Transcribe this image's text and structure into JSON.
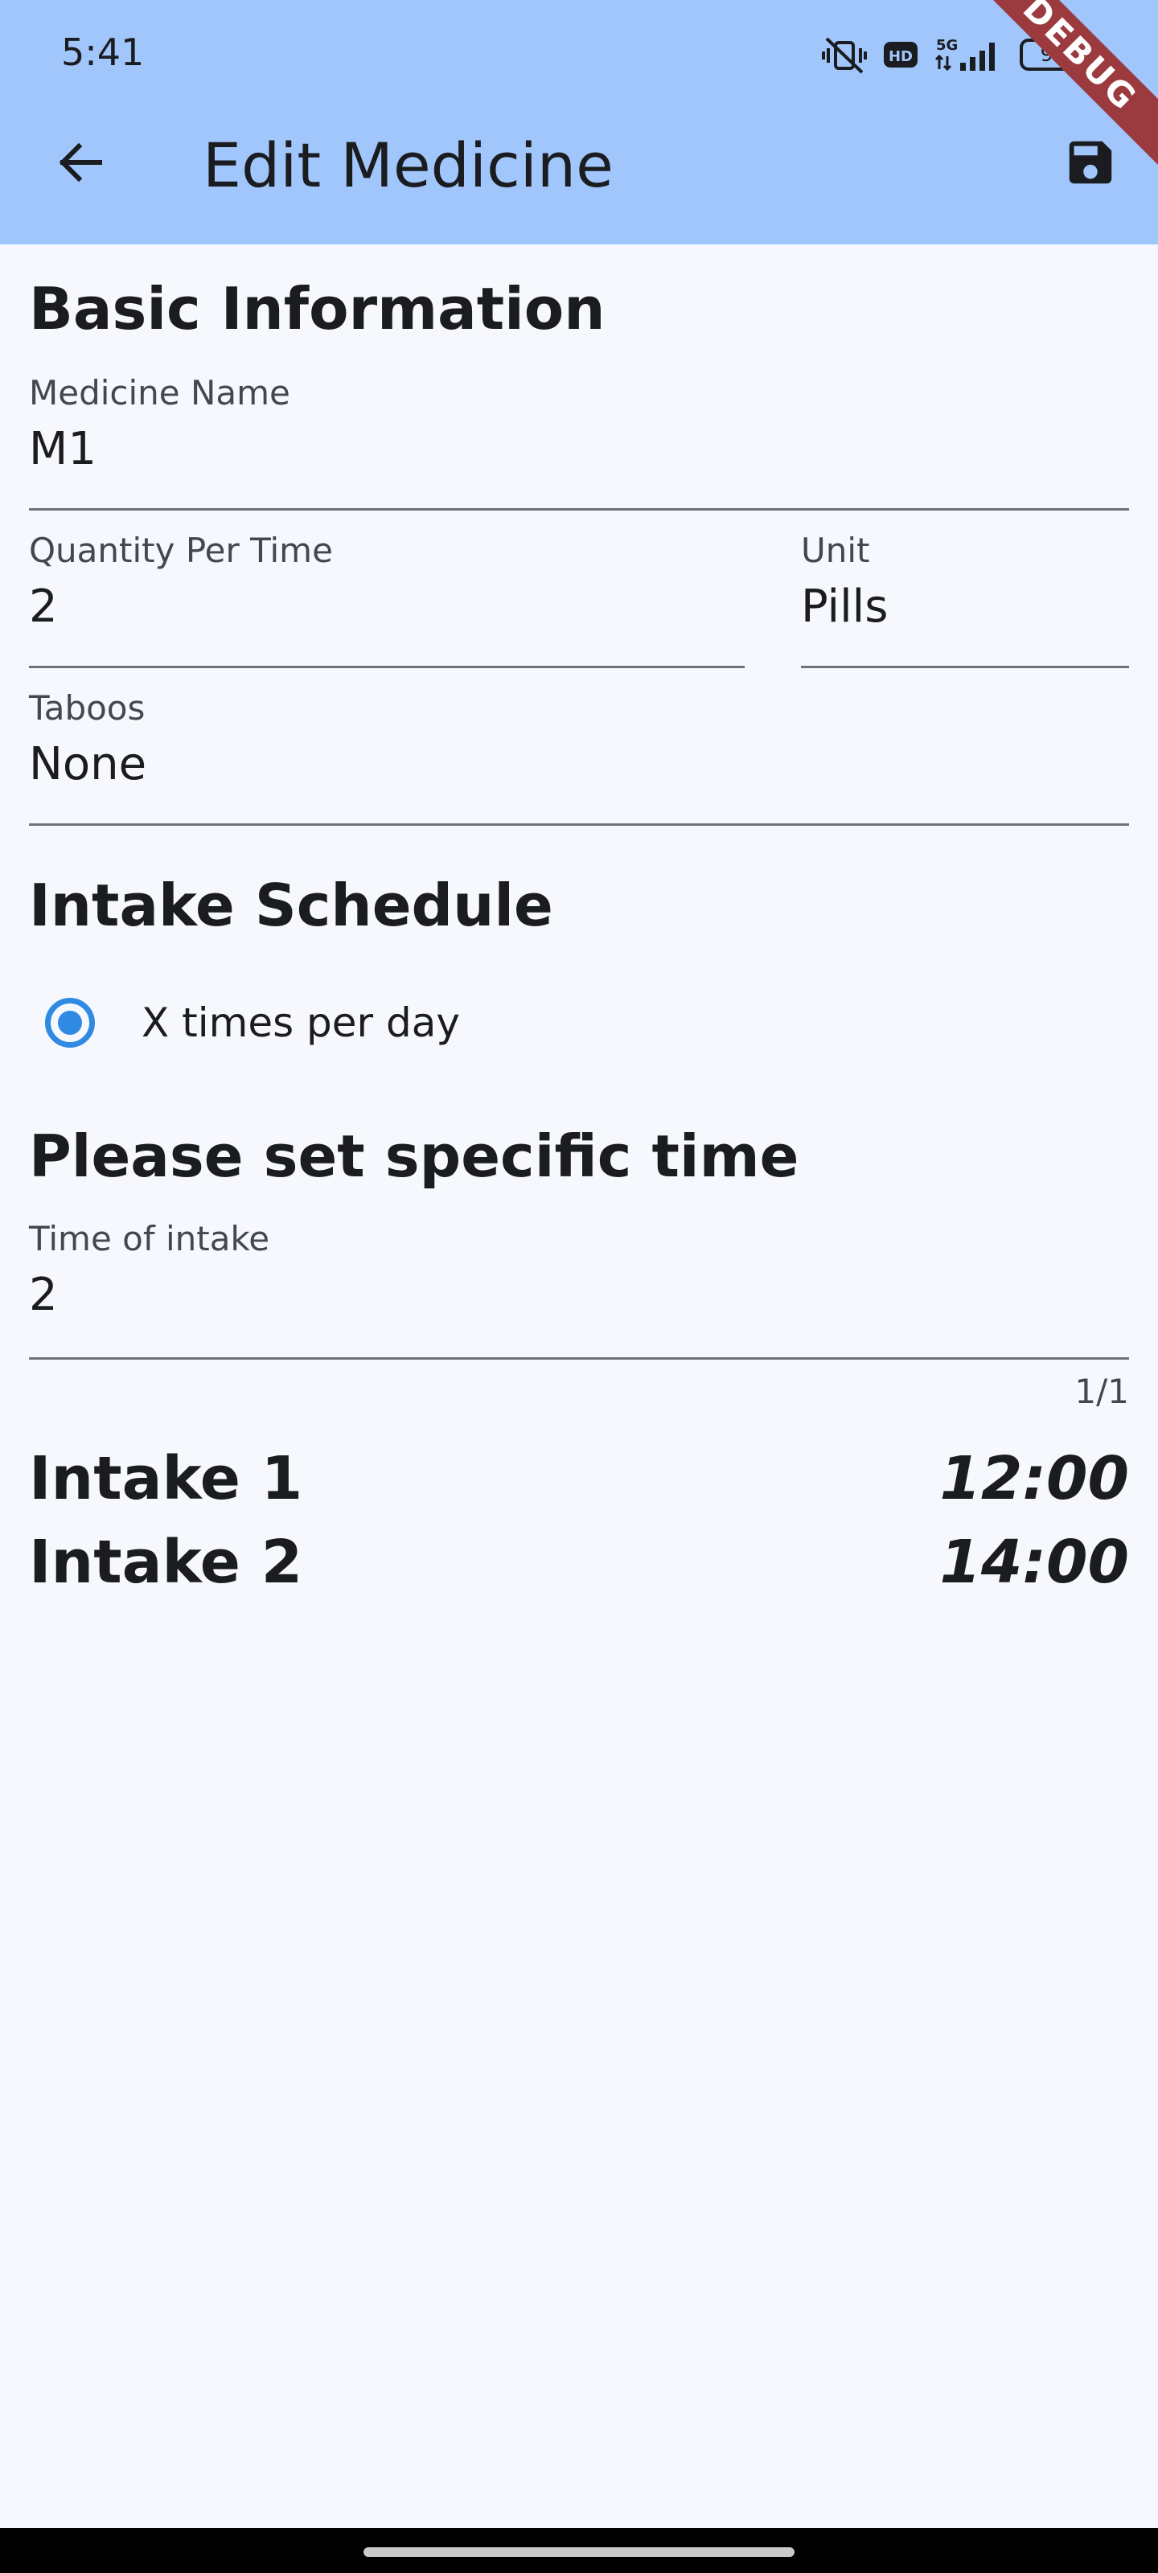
{
  "status_bar": {
    "time": "5:41",
    "icons": [
      "vibrate-off-icon",
      "hd-icon",
      "5g-signal-icon",
      "battery-icon"
    ],
    "battery": "93"
  },
  "debug_banner": "DEBUG",
  "toolbar": {
    "back_icon": "arrow-back-icon",
    "title": "Edit Medicine",
    "save_icon": "save-icon"
  },
  "basic_info": {
    "heading": "Basic Information",
    "medicine_name": {
      "label": "Medicine Name",
      "value": "M1"
    },
    "quantity": {
      "label": "Quantity Per Time",
      "value": "2"
    },
    "unit": {
      "label": "Unit",
      "value": "Pills"
    },
    "taboos": {
      "label": "Taboos",
      "value": "None"
    }
  },
  "schedule": {
    "heading": "Intake Schedule",
    "option_label": "X times per day",
    "option_selected": true
  },
  "specific_time": {
    "heading": "Please set specific time",
    "time_of_intake": {
      "label": "Time of intake",
      "value": "2"
    },
    "counter": "1/1"
  },
  "intakes": [
    {
      "label": "Intake 1",
      "time": "12:00"
    },
    {
      "label": "Intake 2",
      "time": "14:00"
    }
  ],
  "colors": {
    "appbar": "#a1c6fb",
    "background": "#f7f8fd",
    "accent": "#2f8ae3",
    "debug_banner": "#9c3b3f"
  }
}
